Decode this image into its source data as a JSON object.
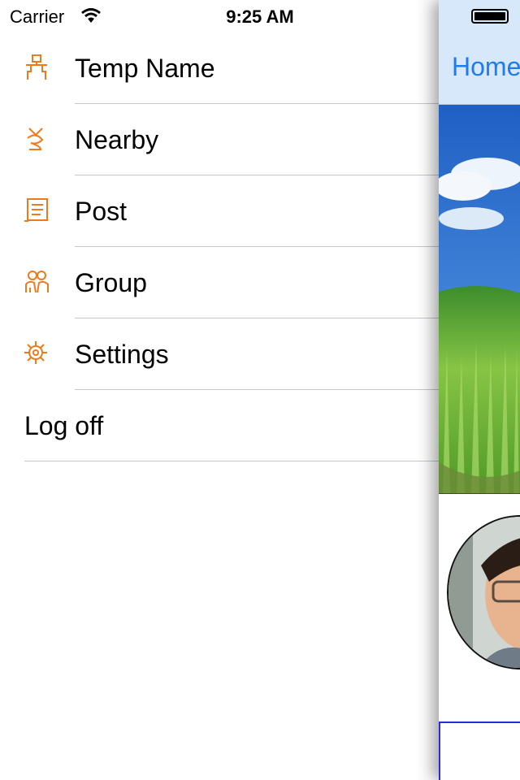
{
  "status_bar": {
    "carrier": "Carrier",
    "time": "9:25 AM"
  },
  "menu": {
    "items": [
      {
        "label": "Temp Name",
        "icon": "person-icon"
      },
      {
        "label": "Nearby",
        "icon": "nearby-icon"
      },
      {
        "label": "Post",
        "icon": "post-icon"
      },
      {
        "label": "Group",
        "icon": "group-icon"
      },
      {
        "label": "Settings",
        "icon": "settings-icon"
      }
    ],
    "log_off": "Log off"
  },
  "content": {
    "nav_title": "Home"
  },
  "colors": {
    "accent_orange": "#f07a1a",
    "nav_blue": "#1e7cf2",
    "navbar_bg": "#d8e8fb"
  }
}
